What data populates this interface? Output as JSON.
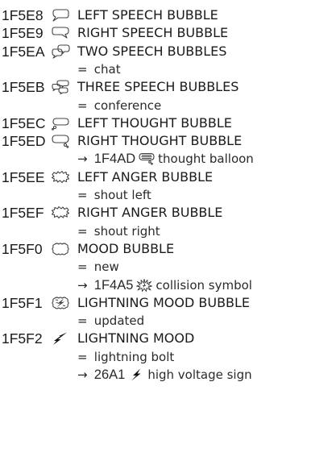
{
  "entries": [
    {
      "code": "1F5E8",
      "glyph_icon": "left-speech-bubble-icon",
      "name": "LEFT SPEECH BUBBLE",
      "notes": []
    },
    {
      "code": "1F5E9",
      "glyph_icon": "right-speech-bubble-icon",
      "name": "RIGHT SPEECH BUBBLE",
      "notes": []
    },
    {
      "code": "1F5EA",
      "glyph_icon": "two-speech-bubbles-icon",
      "name": "TWO SPEECH BUBBLES",
      "notes": [
        {
          "type": "alias",
          "symbol": "=",
          "text": "chat"
        }
      ]
    },
    {
      "code": "1F5EB",
      "glyph_icon": "three-speech-bubbles-icon",
      "name": "THREE SPEECH BUBBLES",
      "notes": [
        {
          "type": "alias",
          "symbol": "=",
          "text": "conference"
        }
      ]
    },
    {
      "code": "1F5EC",
      "glyph_icon": "left-thought-bubble-icon",
      "name": "LEFT THOUGHT BUBBLE",
      "notes": []
    },
    {
      "code": "1F5ED",
      "glyph_icon": "right-thought-bubble-icon",
      "name": "RIGHT THOUGHT BUBBLE",
      "notes": [
        {
          "type": "xref",
          "symbol": "→",
          "ref_code": "1F4AD",
          "ref_icon": "thought-balloon-icon",
          "text": "thought balloon"
        }
      ]
    },
    {
      "code": "1F5EE",
      "glyph_icon": "left-anger-bubble-icon",
      "name": "LEFT ANGER BUBBLE",
      "notes": [
        {
          "type": "alias",
          "symbol": "=",
          "text": "shout left"
        }
      ]
    },
    {
      "code": "1F5EF",
      "glyph_icon": "right-anger-bubble-icon",
      "name": "RIGHT ANGER BUBBLE",
      "notes": [
        {
          "type": "alias",
          "symbol": "=",
          "text": "shout right"
        }
      ]
    },
    {
      "code": "1F5F0",
      "glyph_icon": "mood-bubble-icon",
      "name": "MOOD BUBBLE",
      "notes": [
        {
          "type": "alias",
          "symbol": "=",
          "text": "new"
        },
        {
          "type": "xref",
          "symbol": "→",
          "ref_code": "1F4A5",
          "ref_icon": "collision-symbol-icon",
          "text": "collision symbol"
        }
      ]
    },
    {
      "code": "1F5F1",
      "glyph_icon": "lightning-mood-bubble-icon",
      "name": "LIGHTNING MOOD BUBBLE",
      "notes": [
        {
          "type": "alias",
          "symbol": "=",
          "text": "updated"
        }
      ]
    },
    {
      "code": "1F5F2",
      "glyph_icon": "lightning-mood-icon",
      "name": "LIGHTNING MOOD",
      "notes": [
        {
          "type": "alias",
          "symbol": "=",
          "text": "lightning bolt"
        },
        {
          "type": "xref",
          "symbol": "→",
          "ref_code": "26A1",
          "ref_icon": "high-voltage-sign-icon",
          "text": "high voltage sign"
        }
      ]
    }
  ]
}
